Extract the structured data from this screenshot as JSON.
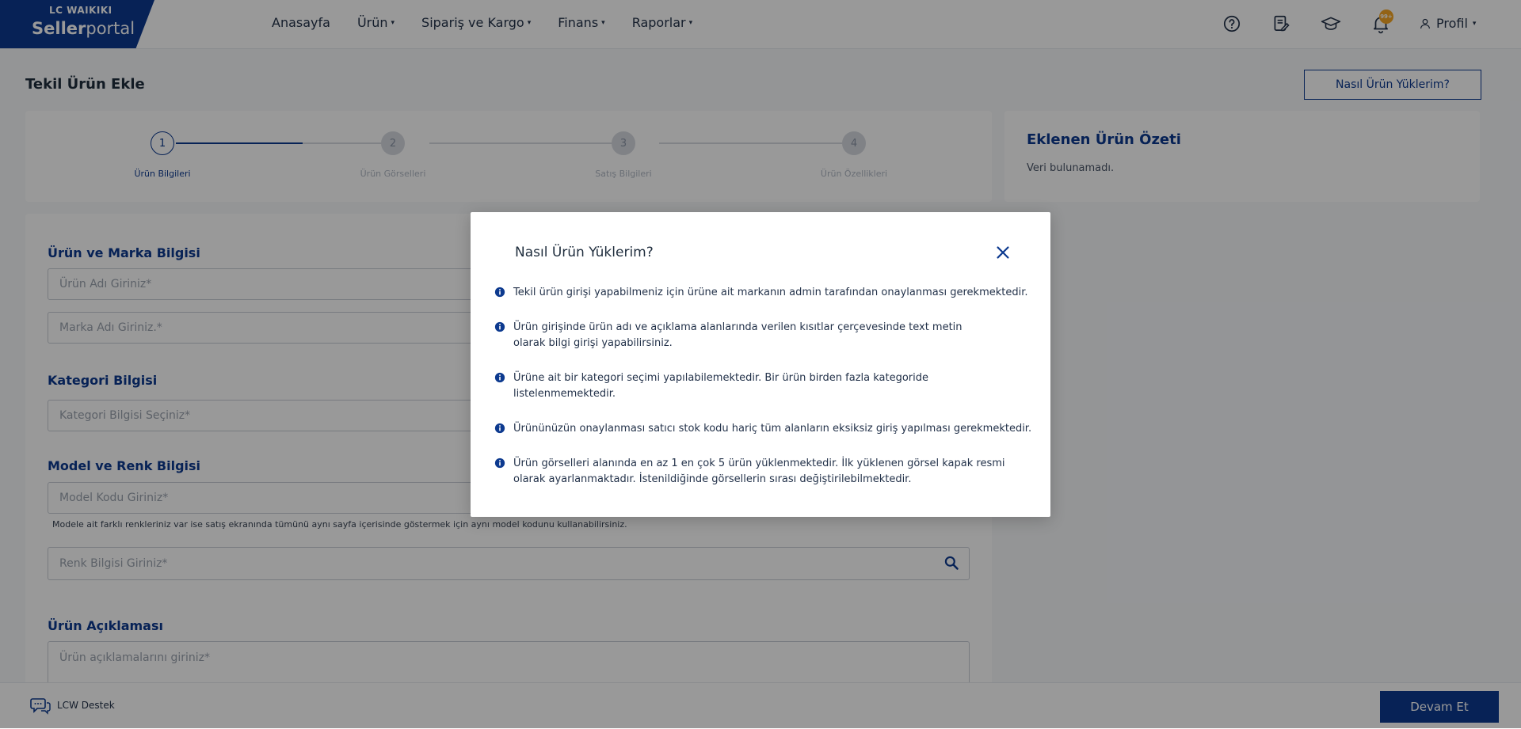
{
  "brand": {
    "top": "LC WAIKIKI",
    "seller": "Seller",
    "portal": "portal"
  },
  "nav": [
    {
      "label": "Anasayfa",
      "caret": false
    },
    {
      "label": "Ürün",
      "caret": true
    },
    {
      "label": "Sipariş ve Kargo",
      "caret": true
    },
    {
      "label": "Finans",
      "caret": true
    },
    {
      "label": "Raporlar",
      "caret": true
    }
  ],
  "header": {
    "notification_badge": "99+",
    "profile_label": "Profil"
  },
  "page": {
    "title": "Tekil Ürün Ekle",
    "how_button": "Nasıl Ürün Yüklerim?"
  },
  "stepper": {
    "steps": [
      {
        "number": "1",
        "label": "Ürün Bilgileri"
      },
      {
        "number": "2",
        "label": "Ürün Görselleri"
      },
      {
        "number": "3",
        "label": "Satış Bilgileri"
      },
      {
        "number": "4",
        "label": "Ürün Özellikleri"
      }
    ]
  },
  "summary": {
    "title": "Eklenen Ürün Özeti",
    "empty_text": "Veri bulunamadı."
  },
  "form": {
    "product_brand_title": "Ürün ve Marka Bilgisi",
    "product_name_placeholder": "Ürün Adı Giriniz*",
    "brand_name_placeholder": "Marka Adı Giriniz.*",
    "category_title": "Kategori Bilgisi",
    "category_placeholder": "Kategori Bilgisi Seçiniz*",
    "model_color_title": "Model ve Renk Bilgisi",
    "model_code_placeholder": "Model Kodu Giriniz*",
    "model_hint": "Modele ait farklı renkleriniz var ise satış ekranında tümünü aynı sayfa içerisinde göstermek için aynı model kodunu kullanabilirsiniz.",
    "color_placeholder": "Renk Bilgisi Giriniz*",
    "description_title": "Ürün Açıklaması",
    "description_placeholder": "Ürün açıklamalarını giriniz*"
  },
  "footer": {
    "support_label": "LCW Destek",
    "continue_button": "Devam Et"
  },
  "modal": {
    "title": "Nasıl Ürün Yüklerim?",
    "items": [
      "Tekil ürün girişi yapabilmeniz için ürüne ait markanın admin tarafından onaylanması gerekmektedir.",
      "Ürün girişinde ürün adı ve açıklama alanlarında verilen kısıtlar çerçevesinde text metin olarak bilgi girişi yapabilirsiniz.",
      "Ürüne ait bir kategori seçimi yapılabilemektedir. Bir ürün birden fazla kategoride listelenmemektedir.",
      "Ürününüzün onaylanması satıcı stok kodu hariç tüm alanların eksiksiz giriş yapılması gerekmektedir.",
      "Ürün görselleri alanında en az 1 en çok 5 ürün yüklenmektedir. İlk yüklenen görsel kapak resmi olarak ayarlanmaktadır. İstenildiğinde görsellerin sırası değiştirilebilmektedir."
    ]
  },
  "colors": {
    "primary": "#0d3a8f",
    "badge": "#f5a623",
    "inactive": "#d5d9e0"
  },
  "icons": [
    "help-icon",
    "document-edit-icon",
    "graduation-cap-icon",
    "bell-icon",
    "user-icon",
    "search-icon",
    "chat-support-icon",
    "close-icon",
    "info-icon"
  ]
}
